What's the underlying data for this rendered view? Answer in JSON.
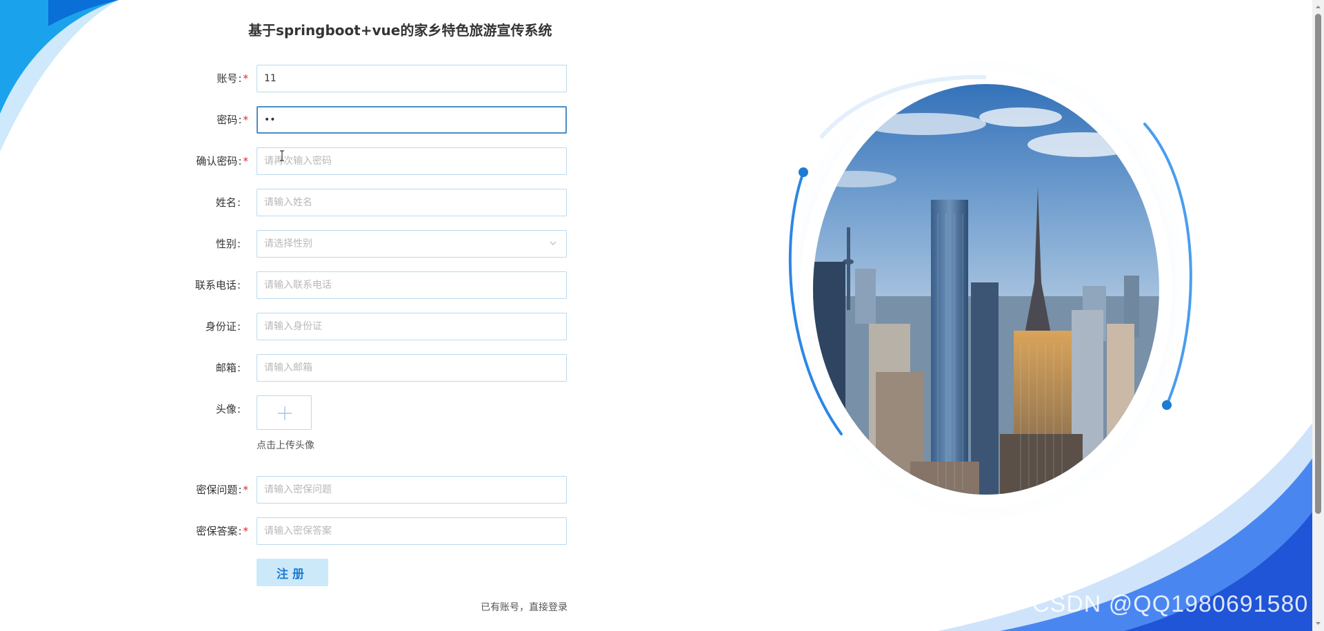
{
  "title": "基于springboot+vue的家乡特色旅游宣传系统",
  "form": {
    "account": {
      "label": "账号",
      "value": "11",
      "required": true
    },
    "password": {
      "label": "密码",
      "value": "••",
      "required": true
    },
    "confirm_password": {
      "label": "确认密码",
      "placeholder": "请再次输入密码",
      "required": true
    },
    "name": {
      "label": "姓名",
      "placeholder": "请输入姓名"
    },
    "gender": {
      "label": "性别",
      "placeholder": "请选择性别"
    },
    "phone": {
      "label": "联系电话",
      "placeholder": "请输入联系电话"
    },
    "id_card": {
      "label": "身份证",
      "placeholder": "请输入身份证"
    },
    "email": {
      "label": "邮箱",
      "placeholder": "请输入邮箱"
    },
    "avatar": {
      "label": "头像",
      "hint": "点击上传头像"
    },
    "security_question": {
      "label": "密保问题",
      "placeholder": "请输入密保问题",
      "required": true
    },
    "security_answer": {
      "label": "密保答案",
      "placeholder": "请输入密保答案",
      "required": true
    },
    "register_label": "注册",
    "login_link": "已有账号，直接登录"
  },
  "watermark": "CSDN @QQ1980691580",
  "colors": {
    "accent": "#1e7bd1",
    "border": "#b9d9ef",
    "focus_border": "#4a8bc7",
    "button_bg": "#cce9f9",
    "required": "#e22222"
  }
}
